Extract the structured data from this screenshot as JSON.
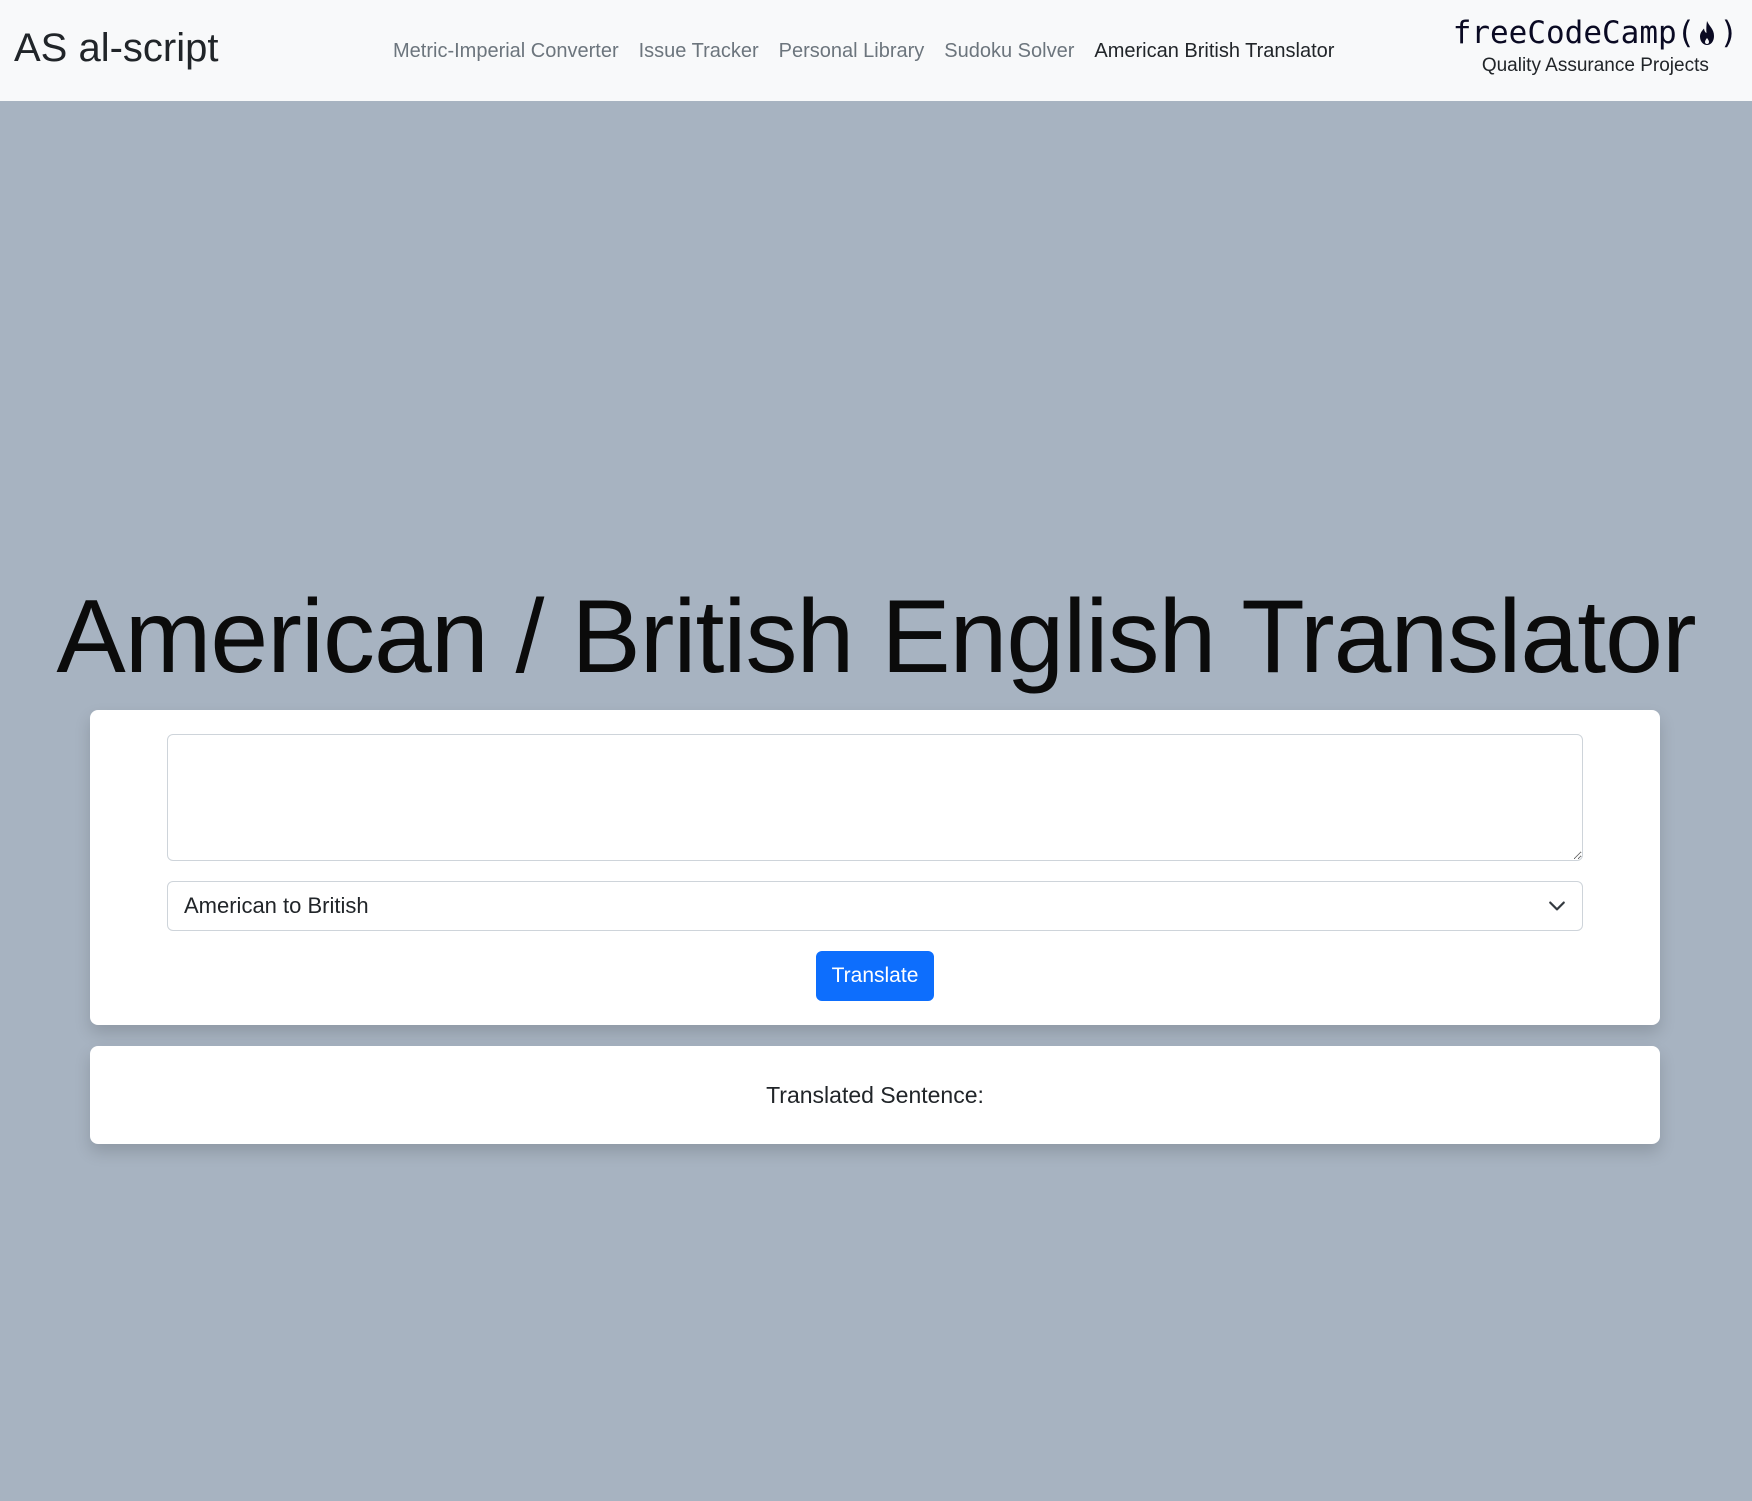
{
  "navbar": {
    "brand": "AS al-script",
    "links": [
      {
        "label": "Metric-Imperial Converter",
        "active": false
      },
      {
        "label": "Issue Tracker",
        "active": false
      },
      {
        "label": "Personal Library",
        "active": false
      },
      {
        "label": "Sudoku Solver",
        "active": false
      },
      {
        "label": "American British Translator",
        "active": true
      }
    ],
    "fcc": {
      "logo_left": "freeCodeCamp(",
      "logo_right": ")",
      "subtitle": "Quality Assurance Projects",
      "icon": "flame-icon"
    }
  },
  "main": {
    "title": "American / British English Translator",
    "text_input": {
      "value": "",
      "placeholder": ""
    },
    "locale_select": {
      "selected": "American to British",
      "icon": "chevron-down-icon"
    },
    "translate_label": "Translate",
    "output": {
      "label": "Translated Sentence:"
    }
  },
  "colors": {
    "background": "#a7b3c1",
    "navbar": "#f8f9fa",
    "primary": "#0d6efd",
    "card": "#ffffff"
  }
}
